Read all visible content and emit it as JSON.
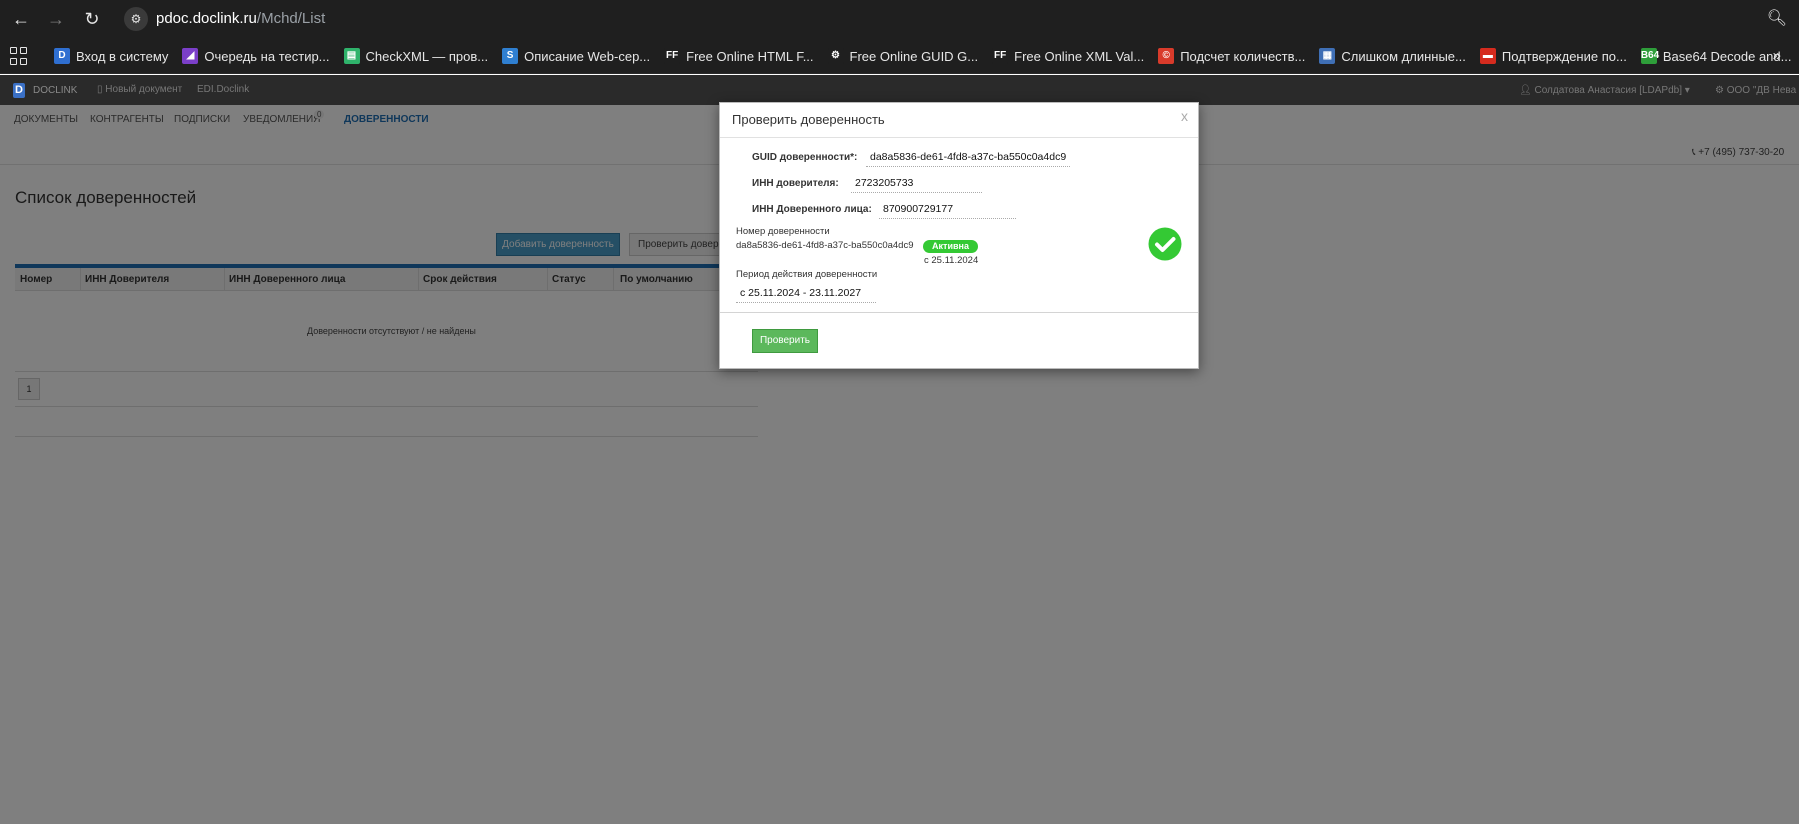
{
  "browser": {
    "url_host": "pdoc.doclink.ru",
    "url_path": "/Mchd/List",
    "bookmarks": [
      {
        "label": "Вход в систему",
        "icon": "doclink-icon",
        "icon_text": "D",
        "color": "#2f6fd1"
      },
      {
        "label": "Очередь на тестир...",
        "icon": "visual-studio-icon",
        "icon_text": "◢",
        "color": "#7b3fc9"
      },
      {
        "label": "CheckXML — пров...",
        "icon": "document-icon",
        "icon_text": "▤",
        "color": "#2fb36b"
      },
      {
        "label": "Описание Web-сер...",
        "icon": "web-service-icon",
        "icon_text": "S",
        "color": "#2f7fd1"
      },
      {
        "label": "Free Online HTML F...",
        "icon": "ff-icon",
        "icon_text": "FF",
        "color": "#1f1f1f"
      },
      {
        "label": "Free Online GUID G...",
        "icon": "gears-icon",
        "icon_text": "⚙",
        "color": "#1f1f1f"
      },
      {
        "label": "Free Online XML Val...",
        "icon": "ff-icon",
        "icon_text": "FF",
        "color": "#1f1f1f"
      },
      {
        "label": "Подсчет количеств...",
        "icon": "copyright-icon",
        "icon_text": "©",
        "color": "#d93b2b"
      },
      {
        "label": "Слишком длинные...",
        "icon": "image-icon",
        "icon_text": "▦",
        "color": "#3f6fb5"
      },
      {
        "label": "Подтверждение по...",
        "icon": "russia-flag-icon",
        "icon_text": "▬",
        "color": "#d52b1e"
      },
      {
        "label": "Base64 Decode and...",
        "icon": "base64-icon",
        "icon_text": "B64",
        "color": "#2e9e3a"
      }
    ]
  },
  "app_header": {
    "logo_text": "DOCLINK",
    "new_doc": "Новый документ",
    "edi": "EDI.Doclink",
    "user": "Солдатова Анастасия [LDAPdb]",
    "org": "ООО \"ДВ Нева"
  },
  "nav": {
    "items": [
      "ДОКУМЕНТЫ",
      "КОНТРАГЕНТЫ",
      "ПОДПИСКИ",
      "УВЕДОМЛЕНИЯ",
      "ДОВЕРЕННОСТИ"
    ],
    "notif_count": "0"
  },
  "phone": "+7 (495) 737-30-20",
  "page": {
    "title": "Список доверенностей",
    "add_button": "Добавить доверенность",
    "check_button": "Проверить доверенность",
    "columns": [
      "Номер",
      "ИНН Доверителя",
      "ИНН Доверенного лица",
      "Срок действия",
      "Статус",
      "По умолчанию"
    ],
    "empty_message": "Доверенности отсутствуют / не найдены",
    "pagination": "1"
  },
  "modal": {
    "title": "Проверить доверенность",
    "close": "x",
    "guid_label": "GUID доверенности*:",
    "guid_value": "da8a5836-de61-4fd8-a37c-ba550c0a4dc9",
    "inn_principal_label": "ИНН доверителя:",
    "inn_principal_value": "2723205733",
    "inn_agent_label": "ИНН Доверенного лица:",
    "inn_agent_value": "870900729177",
    "number_label": "Номер доверенности",
    "number_value": "da8a5836-de61-4fd8-a37c-ba550c0a4dc9",
    "status": "Активна",
    "status_since": "с 25.11.2024",
    "period_label": "Период действия доверенности",
    "period_value": "с 25.11.2024 - 23.11.2027",
    "verify_button": "Проверить"
  },
  "colors": {
    "accent": "#1f6fb5",
    "success": "#34c934",
    "verify_button": "#5cb85c"
  }
}
